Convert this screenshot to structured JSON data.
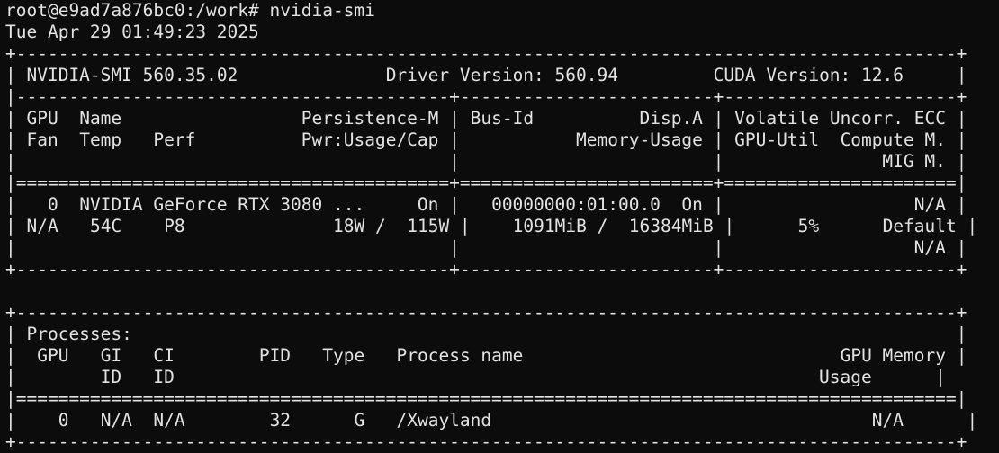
{
  "terminal": {
    "prompt": "root@e9ad7a876bc0:/work#",
    "command": "nvidia-smi",
    "datetime": "Tue Apr 29 01:49:23 2025"
  },
  "summary": {
    "smi_label": "NVIDIA-SMI",
    "smi_version": "560.35.02",
    "driver_label": "Driver Version:",
    "driver_version": "560.94",
    "cuda_label": "CUDA Version:",
    "cuda_version": "12.6"
  },
  "gpu_table": {
    "headers": {
      "row1": {
        "gpu": "GPU",
        "name": "Name",
        "persistence": "Persistence-M",
        "bus_id": "Bus-Id",
        "disp": "Disp.A",
        "volatile": "Volatile Uncorr. ECC"
      },
      "row2": {
        "fan": "Fan",
        "temp": "Temp",
        "perf": "Perf",
        "pwr": "Pwr:Usage/Cap",
        "memory": "Memory-Usage",
        "gpu_util": "GPU-Util",
        "compute": "Compute M."
      },
      "row3": {
        "mig": "MIG M."
      }
    },
    "gpu": {
      "index": "0",
      "name": "NVIDIA GeForce RTX 3080 ...",
      "persistence": "On",
      "bus_id": "00000000:01:00.0",
      "disp": "On",
      "ecc": "N/A",
      "fan": "N/A",
      "temp": "54C",
      "perf": "P8",
      "pwr_usage": "18W",
      "pwr_cap": "115W",
      "mem_used": "1091MiB",
      "mem_total": "16384MiB",
      "gpu_util": "5%",
      "compute_mode": "Default",
      "mig_mode": "N/A"
    }
  },
  "processes": {
    "title": "Processes:",
    "headers": {
      "gpu": "GPU",
      "gi": "GI",
      "gi_sub": "ID",
      "ci": "CI",
      "ci_sub": "ID",
      "pid": "PID",
      "type": "Type",
      "name": "Process name",
      "mem": "GPU Memory",
      "mem_sub": "Usage"
    },
    "rows": [
      {
        "gpu": "0",
        "gi": "N/A",
        "ci": "N/A",
        "pid": "32",
        "type": "G",
        "name": "/Xwayland",
        "mem": "N/A"
      }
    ]
  }
}
